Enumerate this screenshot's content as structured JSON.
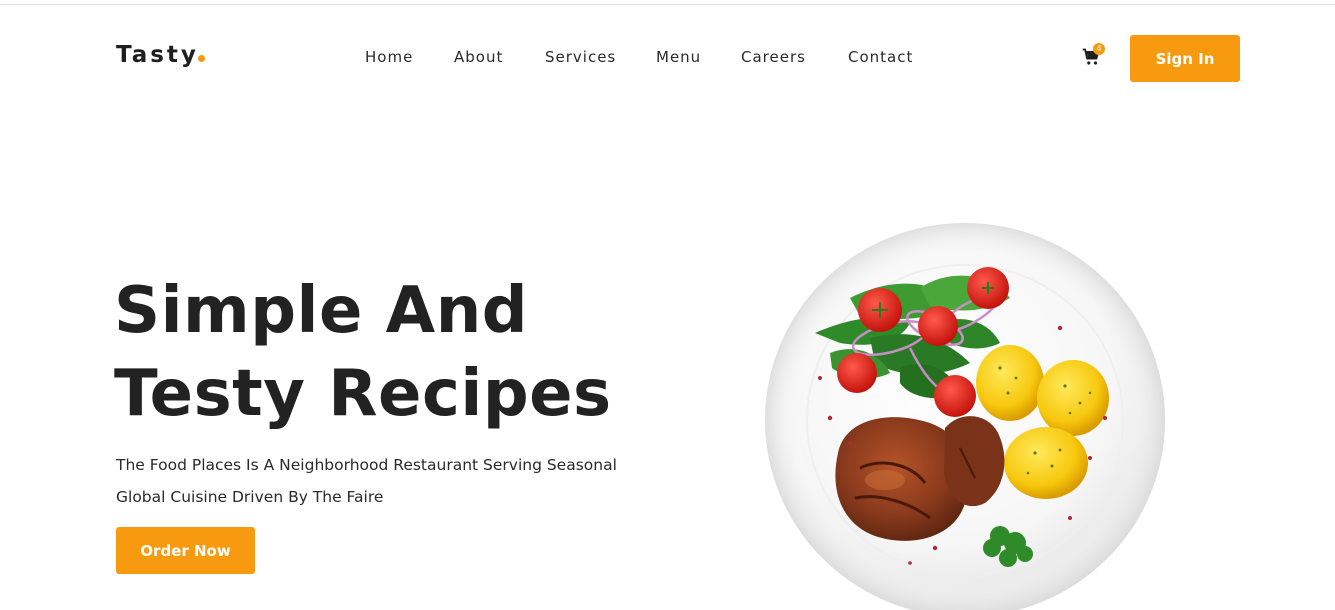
{
  "header": {
    "logo_text": "Tasty",
    "nav": [
      {
        "label": "Home"
      },
      {
        "label": "About"
      },
      {
        "label": "Services"
      },
      {
        "label": "Menu"
      },
      {
        "label": "Careers"
      },
      {
        "label": "Contact"
      }
    ],
    "cart_icon": "cart-icon",
    "cart_count": "4",
    "signin_label": "Sign In"
  },
  "hero": {
    "title_line1": "Simple And",
    "title_line2": "Testy Recipes",
    "description_line1": "The Food Places Is A Neighborhood Restaurant Serving Seasonal",
    "description_line2": "Global Cuisine Driven By The Faire",
    "order_label": "Order Now",
    "image": "plate-of-steak-salad-potatoes"
  },
  "colors": {
    "accent": "#f89a0f",
    "text": "#222222",
    "background": "#ffffff"
  }
}
